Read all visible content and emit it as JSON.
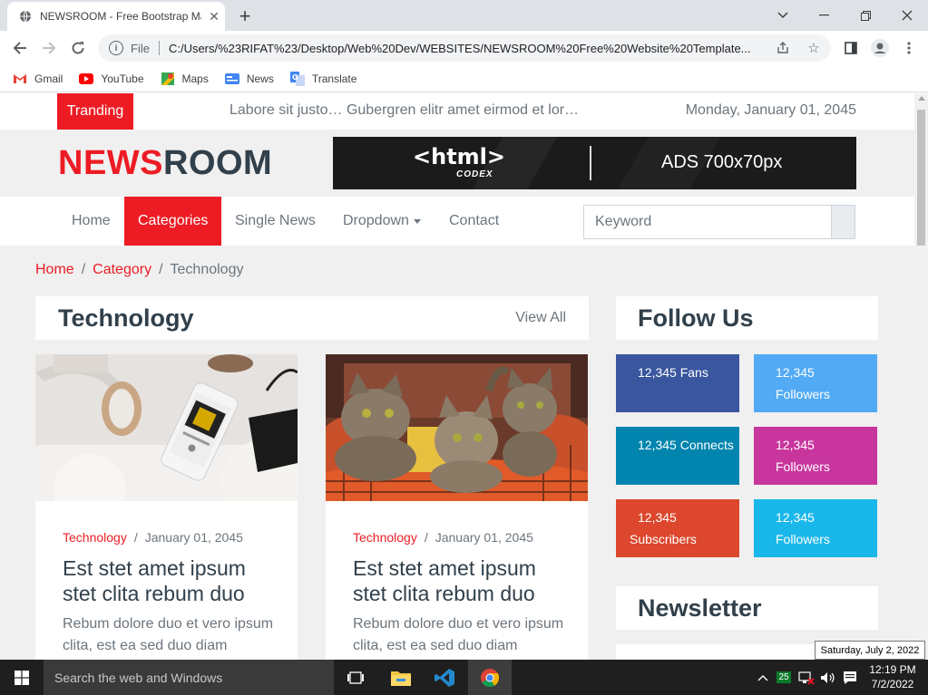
{
  "browser": {
    "tab_title": "NEWSROOM - Free Bootstrap Ma",
    "file_label": "File",
    "url": "C:/Users/%23RIFAT%23/Desktop/Web%20Dev/WEBSITES/NEWSROOM%20Free%20Website%20Template...",
    "bookmarks": [
      {
        "label": "Gmail",
        "icon": "gmail-icon",
        "color": "#ea4335"
      },
      {
        "label": "YouTube",
        "icon": "youtube-icon",
        "color": "#ff0000"
      },
      {
        "label": "Maps",
        "icon": "maps-icon",
        "color": "#34a853"
      },
      {
        "label": "News",
        "icon": "news-icon",
        "color": "#4285f4"
      },
      {
        "label": "Translate",
        "icon": "translate-icon",
        "color": "#4285f4"
      }
    ]
  },
  "topbar": {
    "trending_label": "Tranding",
    "trending_text": "Labore sit justo… Gubergren elitr amet eirmod et lor…",
    "date": "Monday, January 01, 2045"
  },
  "header": {
    "logo_red": "NEWS",
    "logo_dark": "ROOM",
    "ad_brand": "<html>",
    "ad_sub": "CODEX",
    "ad_text": "ADS 700x70px"
  },
  "nav": {
    "items": [
      "Home",
      "Categories",
      "Single News",
      "Dropdown",
      "Contact"
    ],
    "active": "Categories",
    "search_placeholder": "Keyword"
  },
  "breadcrumb": {
    "items": [
      "Home",
      "Category",
      "Technology"
    ]
  },
  "section": {
    "title": "Technology",
    "view_all": "View All"
  },
  "cards": [
    {
      "category": "Technology",
      "date": "January 01, 2045",
      "title": "Est stet amet ipsum stet clita rebum duo",
      "excerpt": "Rebum dolore duo et vero ipsum clita, est ea sed duo diam",
      "image": "phone-headphones-photo"
    },
    {
      "category": "Technology",
      "date": "January 01, 2045",
      "title": "Est stet amet ipsum stet clita rebum duo",
      "excerpt": "Rebum dolore duo et vero ipsum clita, est ea sed duo diam",
      "image": "kittens-photo"
    }
  ],
  "sidebar": {
    "follow_title": "Follow Us",
    "social": [
      {
        "line1": "12,345 Fans",
        "line2": "",
        "color": "#39569e",
        "name": "facebook"
      },
      {
        "line1": "12,345",
        "line2": "Followers",
        "color": "#52aaf4",
        "name": "twitter"
      },
      {
        "line1": "12,345 Connects",
        "line2": "",
        "color": "#0185ae",
        "name": "linkedin"
      },
      {
        "line1": "12,345",
        "line2": "Followers",
        "color": "#c8359d",
        "name": "instagram"
      },
      {
        "line1": "12,345",
        "line2": "Subscribers",
        "color": "#dc472e",
        "name": "youtube"
      },
      {
        "line1": "12,345",
        "line2": "Followers",
        "color": "#1ab7ea",
        "name": "vimeo"
      }
    ],
    "newsletter_title": "Newsletter"
  },
  "tooltip": "Saturday, July 2, 2022",
  "taskbar": {
    "search_placeholder": "Search the web and Windows",
    "time": "12:19 PM",
    "date": "7/2/2022",
    "badge": "25"
  },
  "colors": {
    "accent": "#ed1c24",
    "dark": "#31404b"
  }
}
